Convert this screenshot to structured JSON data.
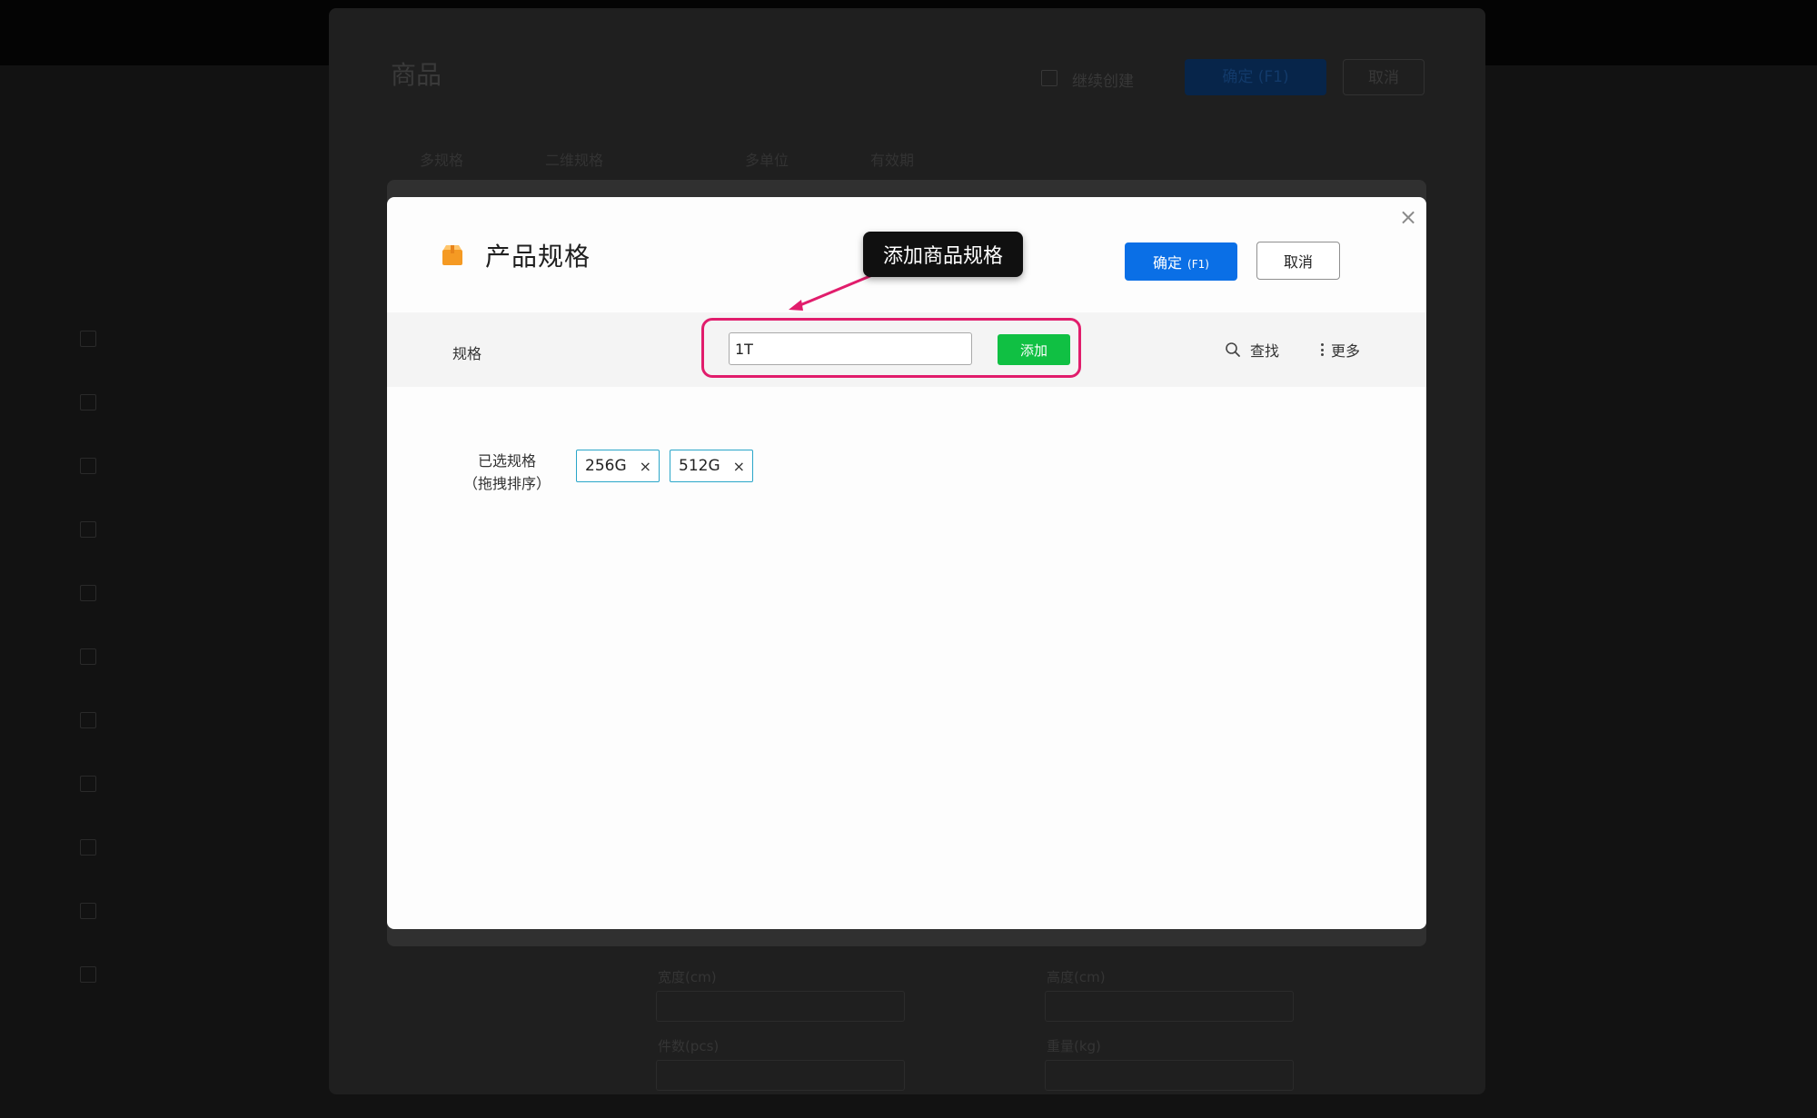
{
  "background": {
    "parent_title": "商品",
    "parent_checkbox_label": "继续创建",
    "parent_confirm_label": "确定 (F1)",
    "parent_cancel_label": "取消",
    "parent_tabs": [
      "多规格",
      "二维规格",
      "多单位",
      "有效期"
    ],
    "parent_fields": [
      "宽度(cm)",
      "高度(cm)",
      "件数(pcs)",
      "重量(kg)"
    ]
  },
  "modal": {
    "title": "产品规格",
    "header_icon": "package-icon",
    "confirm_label": "确定",
    "confirm_shortcut": "(F1)",
    "cancel_label": "取消",
    "close_icon": "close-icon",
    "toolbar": {
      "label": "规格",
      "input_value": "1T",
      "add_label": "添加",
      "search_label": "查找",
      "more_label": "更多"
    },
    "selected": {
      "label_line1": "已选规格",
      "label_line2": "（拖拽排序）",
      "tags": [
        {
          "text": "256G",
          "remove": "×"
        },
        {
          "text": "512G",
          "remove": "×"
        }
      ]
    }
  },
  "annotation": {
    "callout_text": "添加商品规格",
    "highlight_color": "#e11d6c"
  },
  "colors": {
    "primary": "#0a6fe6",
    "success": "#10c043",
    "tag_border": "#2aa6c9"
  }
}
